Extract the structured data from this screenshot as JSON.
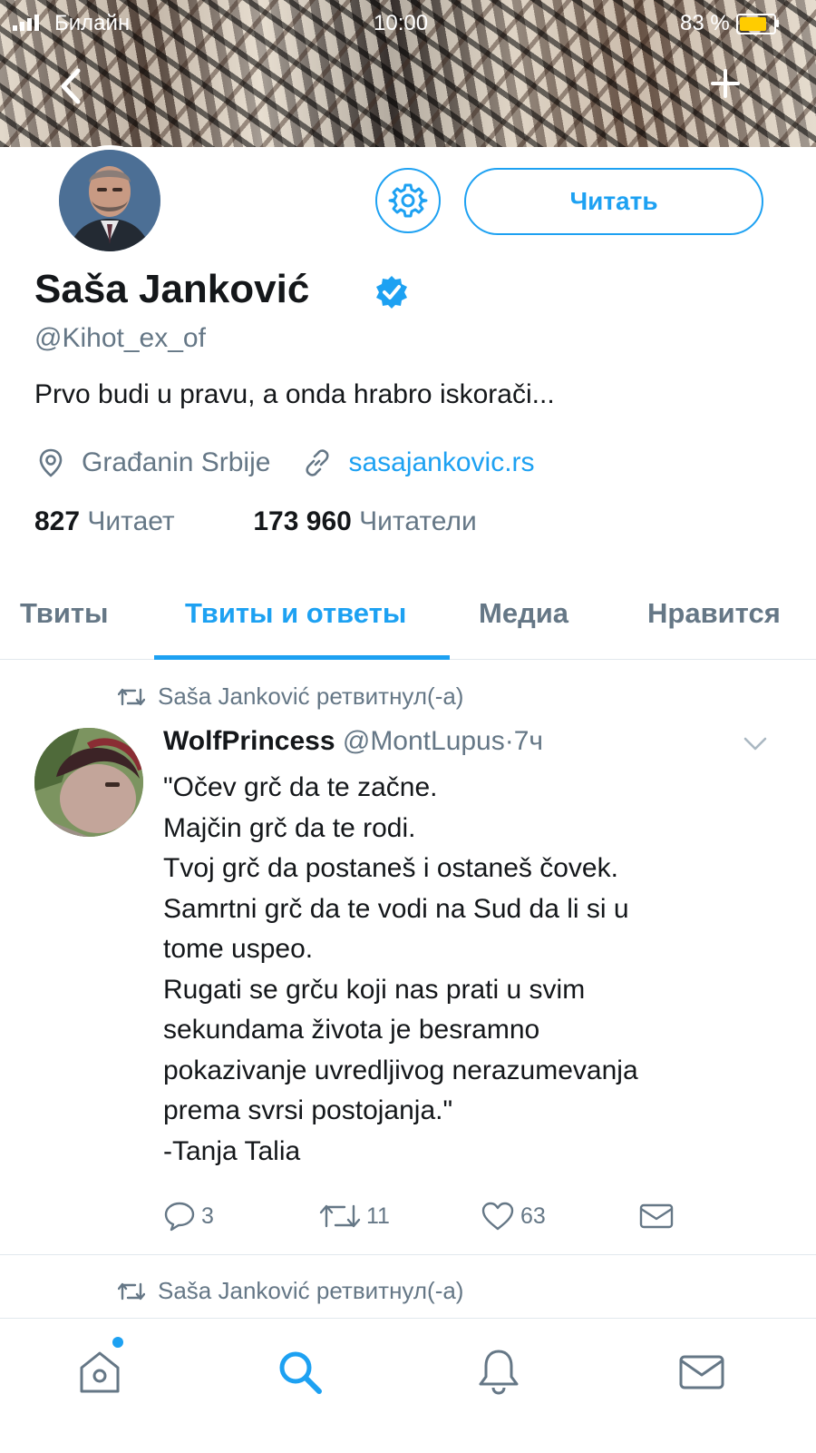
{
  "status_bar": {
    "carrier": "Билайн",
    "time": "10:00",
    "battery_percent": "83 %"
  },
  "profile": {
    "name": "Saša Janković",
    "handle": "@Kihot_ex_of",
    "bio": "Prvo budi u pravu, a onda hrabro iskorači...",
    "location": "Građanin Srbije",
    "website": "sasajankovic.rs",
    "following_count": "827",
    "following_label": "Читает",
    "followers_count": "173 960",
    "followers_label": "Читатели",
    "follow_button_label": "Читать",
    "verified": true
  },
  "tabs": [
    {
      "label": "Твиты",
      "active": false
    },
    {
      "label": "Твиты и ответы",
      "active": true
    },
    {
      "label": "Медиа",
      "active": false
    },
    {
      "label": "Нравится",
      "active": false
    }
  ],
  "timeline": {
    "retweet_notice": "Saša Janković ретвитнул(-а)",
    "tweet": {
      "author_name": "WolfPrincess",
      "author_handle": "@MontLupus",
      "separator": "·",
      "time": "7ч",
      "lines": [
        "\"Očev grč da te začne.",
        "Majčin grč da te rodi.",
        "Tvoj grč da postaneš i ostaneš čovek.",
        "Samrtni grč da te vodi na Sud da li si u",
        "tome uspeo.",
        "Rugati se grču koji nas prati u svim",
        "sekundama života je besramno",
        "pokazivanje uvredljivog nerazumevanja",
        "prema svrsi postojanja.\"",
        "-Tanja Talia"
      ],
      "replies": "3",
      "retweets": "11",
      "likes": "63"
    },
    "next_retweet_notice": "Saša Janković ретвитнул(-а)"
  },
  "colors": {
    "accent": "#1da1f2",
    "secondary_text": "#657786",
    "primary_text": "#14171a",
    "divider": "#e1e8ed",
    "battery": "#ffcc00"
  },
  "icons": {
    "back": "chevron-left-icon",
    "add": "plus-icon",
    "settings": "gear-icon",
    "verified": "verified-badge-icon",
    "location": "location-pin-icon",
    "link": "link-icon",
    "retweet": "retweet-icon",
    "reply": "reply-icon",
    "like": "heart-icon",
    "dm": "envelope-icon",
    "home": "home-icon",
    "search": "search-icon",
    "notifications": "bell-icon",
    "messages": "envelope-icon"
  }
}
